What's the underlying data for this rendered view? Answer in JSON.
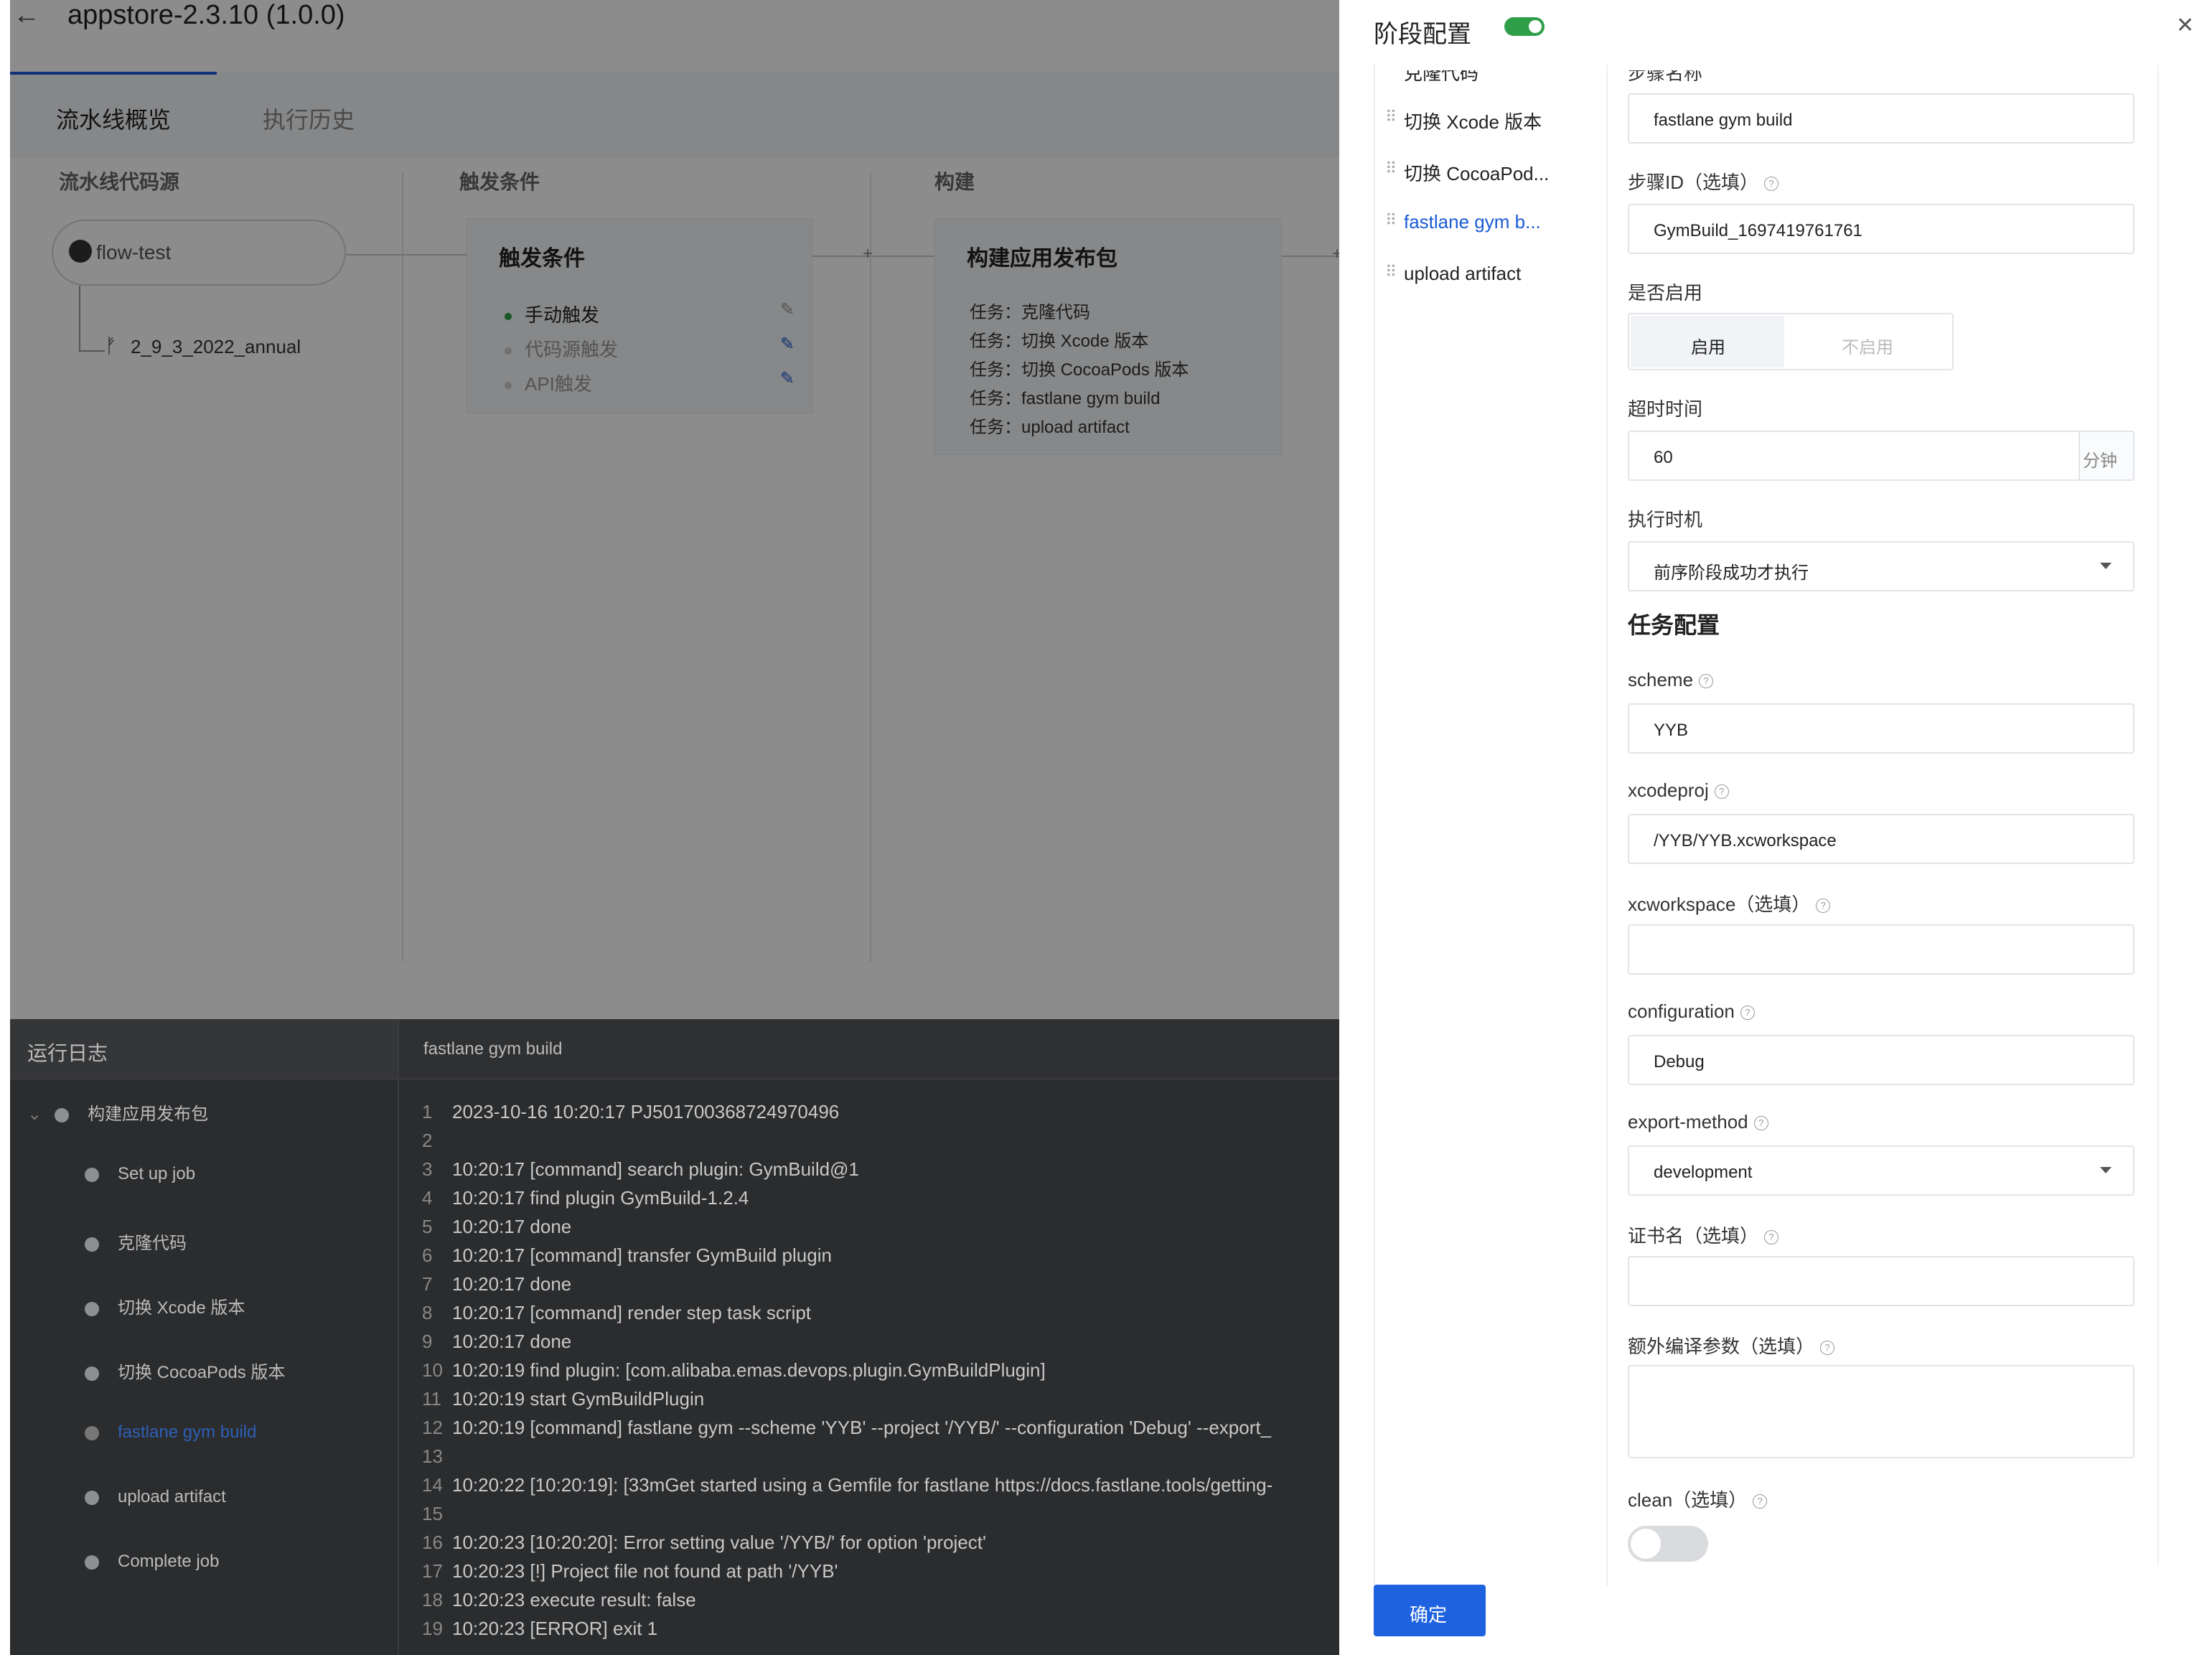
{
  "header": {
    "title": "appstore-2.3.10 (1.0.0)"
  },
  "tabs": [
    {
      "label": "流水线概览"
    },
    {
      "label": "执行历史"
    }
  ],
  "columns": {
    "source": "流水线代码源",
    "trigger": "触发条件",
    "build": "构建"
  },
  "source": {
    "repo": "flow-test",
    "branch": "2_9_3_2022_annual"
  },
  "trigger_card": {
    "title": "触发条件",
    "items": [
      {
        "label": "手动触发"
      },
      {
        "label": "代码源触发"
      },
      {
        "label": "API触发"
      }
    ]
  },
  "build_card": {
    "title": "构建应用发布包",
    "tasks": [
      "任务：克隆代码",
      "任务：切换 Xcode 版本",
      "任务：切换 CocoaPods 版本",
      "任务：fastlane gym build",
      "任务：upload artifact"
    ]
  },
  "log": {
    "title": "运行日志",
    "current_step": "fastlane gym build",
    "group": "构建应用发布包",
    "steps": [
      {
        "label": "Set up job"
      },
      {
        "label": "克隆代码"
      },
      {
        "label": "切换 Xcode 版本"
      },
      {
        "label": "切换 CocoaPods 版本"
      },
      {
        "label": "fastlane gym build"
      },
      {
        "label": "upload artifact"
      },
      {
        "label": "Complete job"
      }
    ],
    "lines": [
      {
        "n": "1",
        "text": "2023-10-16 10:20:17 PJ501700368724970496"
      },
      {
        "n": "2",
        "text": ""
      },
      {
        "n": "3",
        "text": "10:20:17 [command] search plugin: GymBuild@1"
      },
      {
        "n": "4",
        "text": "10:20:17 find plugin GymBuild-1.2.4"
      },
      {
        "n": "5",
        "text": "10:20:17 done"
      },
      {
        "n": "6",
        "text": "10:20:17 [command] transfer GymBuild plugin"
      },
      {
        "n": "7",
        "text": "10:20:17 done"
      },
      {
        "n": "8",
        "text": "10:20:17 [command] render step task script"
      },
      {
        "n": "9",
        "text": "10:20:17 done"
      },
      {
        "n": "10",
        "text": "10:20:19 find plugin: [com.alibaba.emas.devops.plugin.GymBuildPlugin]"
      },
      {
        "n": "11",
        "text": "10:20:19 start GymBuildPlugin"
      },
      {
        "n": "12",
        "text": "10:20:19 [command] fastlane gym --scheme 'YYB' --project '/YYB/' --configuration 'Debug' --export_"
      },
      {
        "n": "13",
        "text": ""
      },
      {
        "n": "14",
        "text": "10:20:22 [10:20:19]:  [33mGet started using a Gemfile for fastlane https://docs.fastlane.tools/getting-"
      },
      {
        "n": "15",
        "text": ""
      },
      {
        "n": "16",
        "text": "10:20:23 [10:20:20]: Error setting value '/YYB/' for option 'project'"
      },
      {
        "n": "17",
        "text": "10:20:23 [!] Project file not found at path '/YYB'"
      },
      {
        "n": "18",
        "text": "10:20:23 execute result: false"
      },
      {
        "n": "19",
        "text": "10:20:23 [ERROR] exit 1"
      }
    ]
  },
  "drawer": {
    "title": "阶段配置",
    "nav": [
      {
        "label": "克隆代码"
      },
      {
        "label": "切换 Xcode 版本"
      },
      {
        "label": "切换 CocoaPod..."
      },
      {
        "label": "fastlane gym b..."
      },
      {
        "label": "upload artifact"
      }
    ],
    "fields": {
      "step_name_label": "步骤名称",
      "step_name": "fastlane gym build",
      "step_id_label": "步骤ID（选填）",
      "step_id": "GymBuild_1697419761761",
      "enabled_label": "是否启用",
      "enabled_on": "启用",
      "enabled_off": "不启用",
      "timeout_label": "超时时间",
      "timeout": "60",
      "timeout_unit": "分钟",
      "exec_label": "执行时机",
      "exec": "前序阶段成功才执行",
      "task_section": "任务配置",
      "scheme_label": "scheme",
      "scheme": "YYB",
      "xcodeproj_label": "xcodeproj",
      "xcodeproj": "/YYB/YYB.xcworkspace",
      "xcworkspace_label": "xcworkspace（选填）",
      "xcworkspace": "",
      "configuration_label": "configuration",
      "configuration": "Debug",
      "export_label": "export-method",
      "export": "development",
      "cert_label": "证书名（选填）",
      "cert": "",
      "extra_label": "额外编译参数（选填）",
      "clean_label": "clean（选填）"
    },
    "ok": "确定"
  }
}
